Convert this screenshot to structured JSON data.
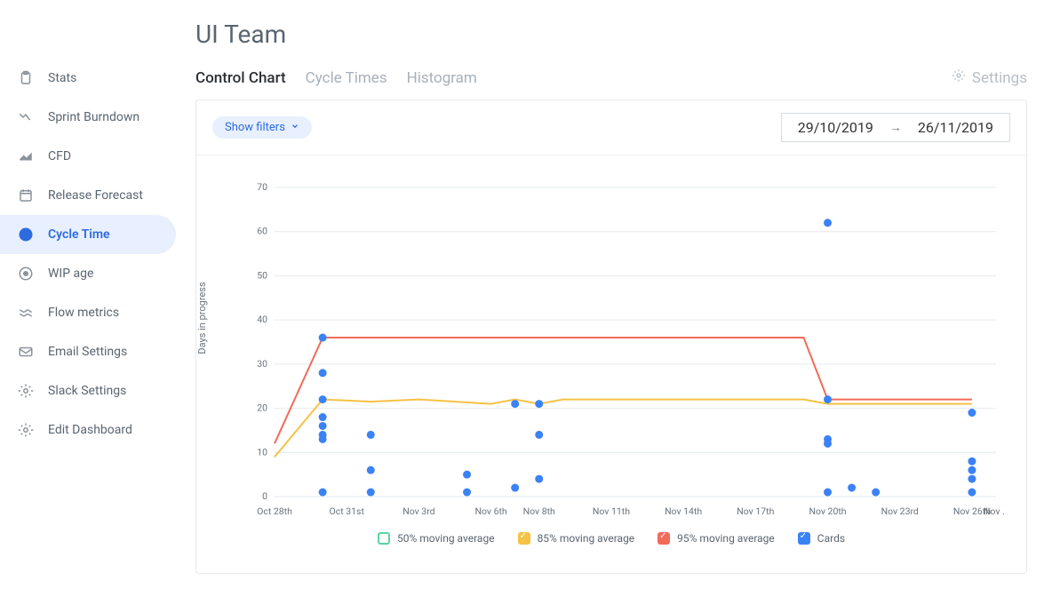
{
  "page": {
    "title": "UI Team"
  },
  "sidebar": {
    "items": [
      {
        "label": "Stats",
        "icon": "clipboard-icon"
      },
      {
        "label": "Sprint Burndown",
        "icon": "burndown-icon"
      },
      {
        "label": "CFD",
        "icon": "cfd-icon"
      },
      {
        "label": "Release Forecast",
        "icon": "calendar-icon"
      },
      {
        "label": "Cycle Time",
        "icon": "clock-icon",
        "active": true
      },
      {
        "label": "WIP age",
        "icon": "gauge-icon"
      },
      {
        "label": "Flow metrics",
        "icon": "waves-icon"
      },
      {
        "label": "Email Settings",
        "icon": "mail-icon"
      },
      {
        "label": "Slack Settings",
        "icon": "gear-icon"
      },
      {
        "label": "Edit Dashboard",
        "icon": "gear-icon"
      }
    ]
  },
  "tabs": {
    "items": [
      {
        "label": "Control Chart",
        "active": true
      },
      {
        "label": "Cycle Times"
      },
      {
        "label": "Histogram"
      }
    ],
    "settings": "Settings"
  },
  "filters": {
    "button": "Show filters"
  },
  "date_range": {
    "from": "29/10/2019",
    "to": "26/11/2019"
  },
  "legend": {
    "items": [
      {
        "label": "50% moving average",
        "style": "outline"
      },
      {
        "label": "85% moving average",
        "style": "yellow"
      },
      {
        "label": "95% moving average",
        "style": "red"
      },
      {
        "label": "Cards",
        "style": "blue"
      }
    ]
  },
  "chart_data": {
    "type": "scatter",
    "ylabel": "Days in progress",
    "xlabel": "",
    "ylim": [
      0,
      70
    ],
    "y_ticks": [
      0,
      10,
      20,
      30,
      40,
      50,
      60,
      70
    ],
    "x_ticks": [
      "Oct 28th",
      "Oct 31st",
      "Nov 3rd",
      "Nov 6th",
      "Nov 8th",
      "Nov 11th",
      "Nov 14th",
      "Nov 17th",
      "Nov 20th",
      "Nov 23rd",
      "Nov 26th",
      "Nov …"
    ],
    "series": [
      {
        "name": "95% moving average",
        "type": "line",
        "color": "#f26b5a",
        "points": [
          {
            "x": "Oct 28th",
            "y": 12
          },
          {
            "x": "Oct 30th",
            "y": 36
          },
          {
            "x": "Nov 19th",
            "y": 36
          },
          {
            "x": "Nov 20th",
            "y": 22
          },
          {
            "x": "Nov 26th",
            "y": 22
          }
        ]
      },
      {
        "name": "85% moving average",
        "type": "line",
        "color": "#f4c244",
        "points": [
          {
            "x": "Oct 28th",
            "y": 9
          },
          {
            "x": "Oct 30th",
            "y": 22
          },
          {
            "x": "Nov 1st",
            "y": 21.5
          },
          {
            "x": "Nov 3rd",
            "y": 22
          },
          {
            "x": "Nov 6th",
            "y": 21
          },
          {
            "x": "Nov 7th",
            "y": 22
          },
          {
            "x": "Nov 8th",
            "y": 21
          },
          {
            "x": "Nov 9th",
            "y": 22
          },
          {
            "x": "Nov 19th",
            "y": 22
          },
          {
            "x": "Nov 20th",
            "y": 21
          },
          {
            "x": "Nov 26th",
            "y": 21
          }
        ]
      },
      {
        "name": "Cards",
        "type": "scatter",
        "color": "#3b82f6",
        "points": [
          {
            "x": "Oct 30th",
            "y": 36
          },
          {
            "x": "Oct 30th",
            "y": 28
          },
          {
            "x": "Oct 30th",
            "y": 22
          },
          {
            "x": "Oct 30th",
            "y": 18
          },
          {
            "x": "Oct 30th",
            "y": 16
          },
          {
            "x": "Oct 30th",
            "y": 14
          },
          {
            "x": "Oct 30th",
            "y": 13
          },
          {
            "x": "Oct 30th",
            "y": 1
          },
          {
            "x": "Nov 1st",
            "y": 14
          },
          {
            "x": "Nov 1st",
            "y": 6
          },
          {
            "x": "Nov 1st",
            "y": 1
          },
          {
            "x": "Nov 5th",
            "y": 5
          },
          {
            "x": "Nov 5th",
            "y": 1
          },
          {
            "x": "Nov 7th",
            "y": 21
          },
          {
            "x": "Nov 7th",
            "y": 2
          },
          {
            "x": "Nov 8th",
            "y": 21
          },
          {
            "x": "Nov 8th",
            "y": 14
          },
          {
            "x": "Nov 8th",
            "y": 4
          },
          {
            "x": "Nov 20th",
            "y": 62
          },
          {
            "x": "Nov 20th",
            "y": 22
          },
          {
            "x": "Nov 20th",
            "y": 13
          },
          {
            "x": "Nov 20th",
            "y": 12
          },
          {
            "x": "Nov 20th",
            "y": 1
          },
          {
            "x": "Nov 21st",
            "y": 2
          },
          {
            "x": "Nov 22nd",
            "y": 1
          },
          {
            "x": "Nov 26th",
            "y": 19
          },
          {
            "x": "Nov 26th",
            "y": 8
          },
          {
            "x": "Nov 26th",
            "y": 6
          },
          {
            "x": "Nov 26th",
            "y": 4
          },
          {
            "x": "Nov 26th",
            "y": 1
          }
        ]
      }
    ]
  }
}
